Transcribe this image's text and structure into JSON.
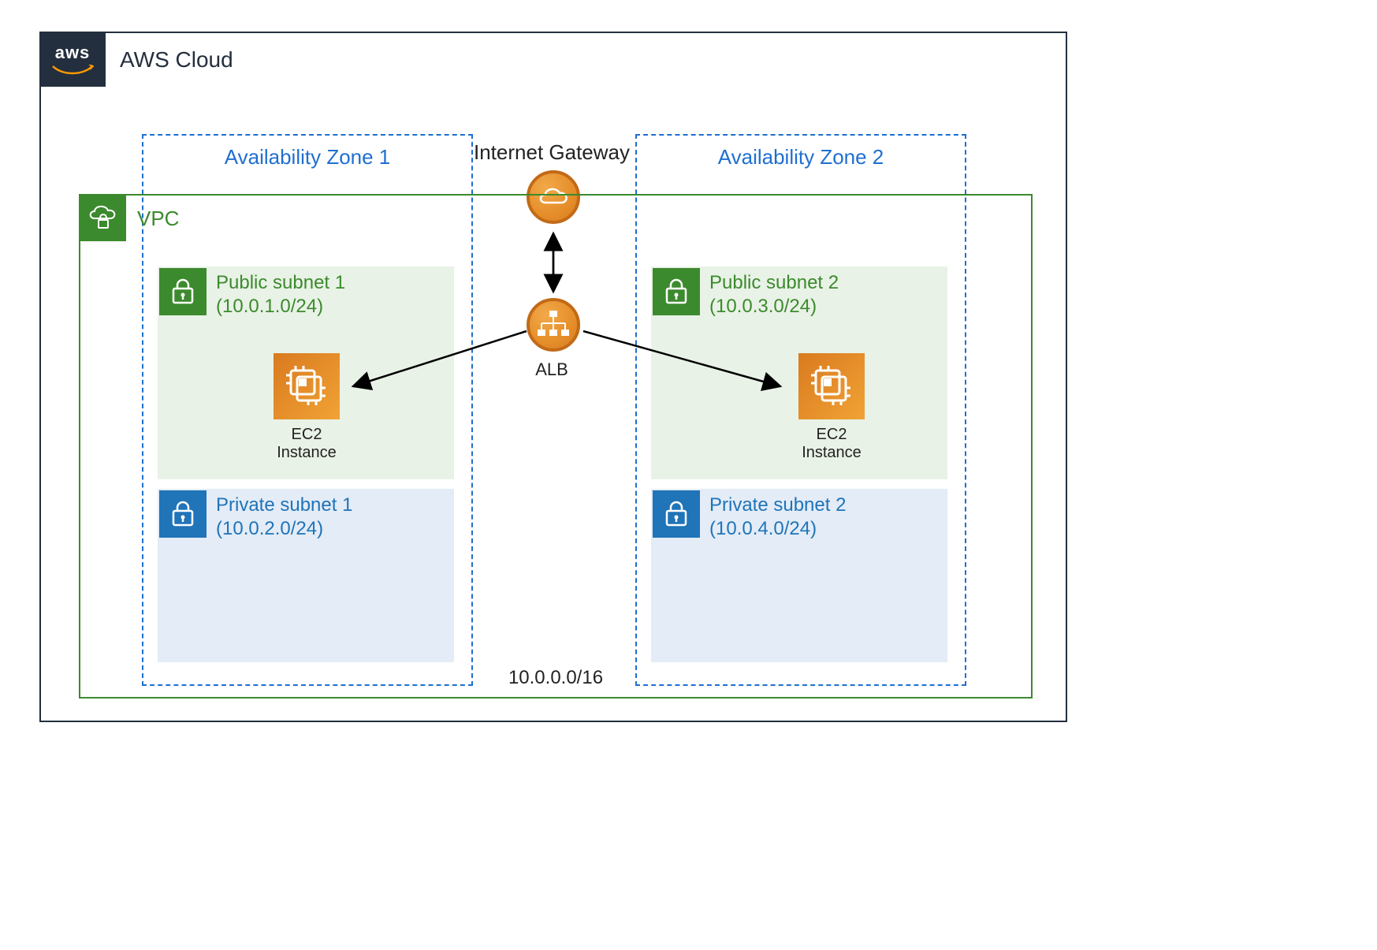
{
  "cloud": {
    "title": "AWS Cloud",
    "logo_text": "aws"
  },
  "vpc": {
    "title": "VPC",
    "cidr": "10.0.0.0/16"
  },
  "az": {
    "z1": "Availability Zone 1",
    "z2": "Availability Zone 2"
  },
  "igw": {
    "label": "Internet Gateway"
  },
  "alb": {
    "label": "ALB"
  },
  "subnets": {
    "pub1": {
      "name": "Public subnet 1",
      "cidr": "(10.0.1.0/24)"
    },
    "priv1": {
      "name": "Private subnet 1",
      "cidr": "(10.0.2.0/24)"
    },
    "pub2": {
      "name": "Public subnet 2",
      "cidr": "(10.0.3.0/24)"
    },
    "priv2": {
      "name": "Private subnet 2",
      "cidr": "(10.0.4.0/24)"
    }
  },
  "ec2": {
    "label": "EC2 Instance"
  },
  "colors": {
    "cloud_border": "#232f3e",
    "az_border": "#1f6fd0",
    "vpc_green": "#3c8a2e",
    "subnet_blue": "#2074b8",
    "orange": "#e58e2a"
  }
}
